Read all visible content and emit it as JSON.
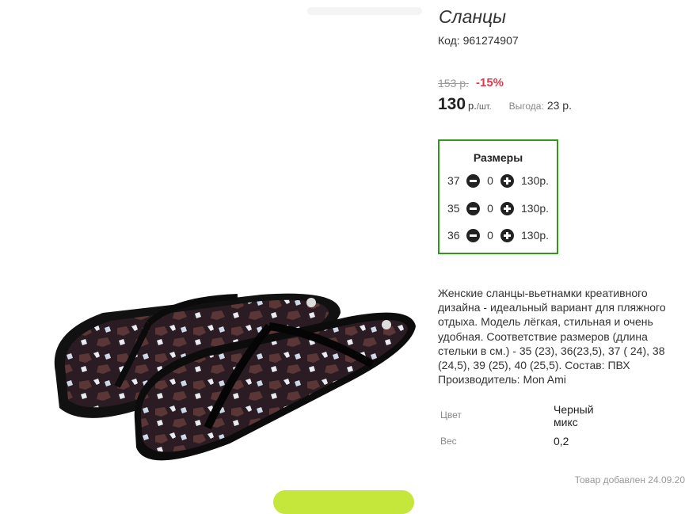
{
  "product": {
    "title": "Сланцы",
    "code": "Код: 961274907",
    "old_price": "153 р.",
    "discount": "-15%",
    "price": "130",
    "price_unit": "р.",
    "price_per": "/шт.",
    "benefit_label": "Выгода:",
    "benefit_value": "23 р.",
    "image_alt": "flip-flops-photo"
  },
  "sizes": {
    "title": "Размеры",
    "rows": [
      {
        "size": "37",
        "qty": "0",
        "price": "130р."
      },
      {
        "size": "35",
        "qty": "0",
        "price": "130р."
      },
      {
        "size": "36",
        "qty": "0",
        "price": "130р."
      }
    ]
  },
  "description": "Женские сланцы-вьетнамки креативного дизайна - идеальный вариант для пляжного отдыха. Модель лёгкая, стильная и очень удобная. Соответствие размеров (длина стельки в см.) - 35 (23), 36(23,5), 37 ( 24), 38 (24,5), 39 (25), 40 (25,5). Состав: ПВХ Производитель: Mon Ami",
  "attributes": [
    {
      "label": "Цвет",
      "value": "Черный микс"
    },
    {
      "label": "Вес",
      "value": "0,2"
    }
  ],
  "added": "Товар добавлен 24.09.20",
  "colors": {
    "accent_green": "#2e9a1a",
    "discount_red": "#e2384d",
    "cta": "#c5e63a"
  }
}
